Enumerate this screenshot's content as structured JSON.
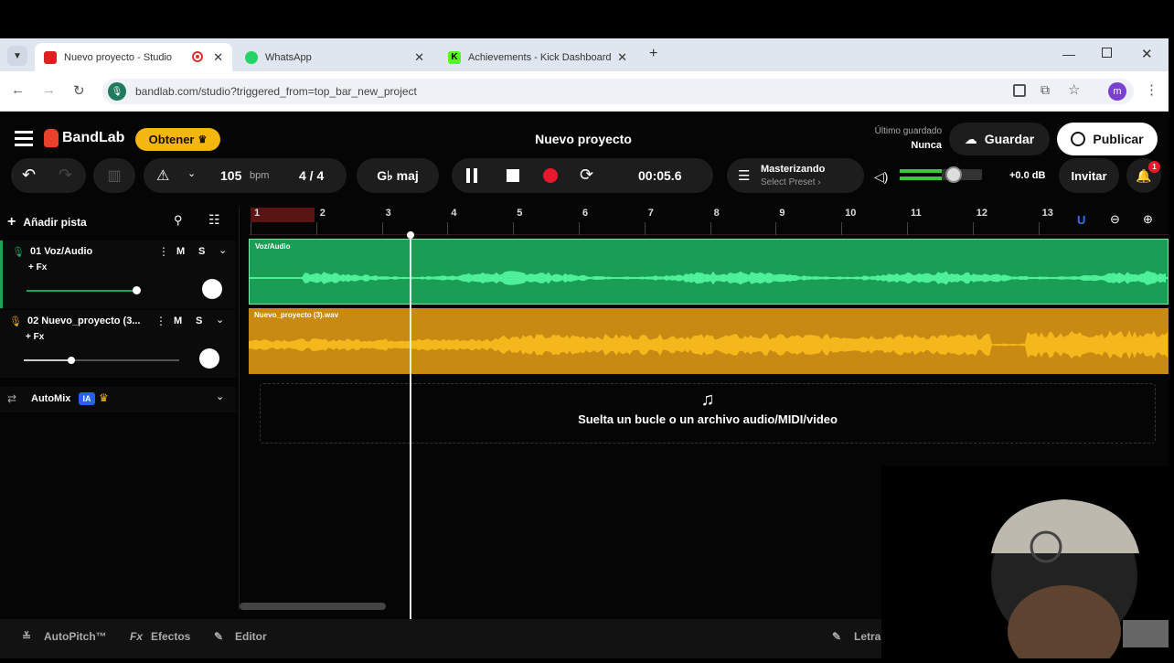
{
  "browser": {
    "tabs": [
      {
        "title": "Nuevo proyecto - Studio",
        "active": true
      },
      {
        "title": "WhatsApp",
        "active": false
      },
      {
        "title": "Achievements - Kick Dashboard",
        "active": false
      }
    ],
    "url": "bandlab.com/studio?triggered_from=top_bar_new_project",
    "profile_initial": "m"
  },
  "app": {
    "logo": "BandLab",
    "get_button": "Obtener",
    "project_title": "Nuevo proyecto",
    "last_saved_label": "Último guardado",
    "last_saved_value": "Nunca",
    "save_button": "Guardar",
    "publish_button": "Publicar"
  },
  "toolbar": {
    "bpm_value": "105",
    "bpm_unit": "bpm",
    "time_signature": "4 / 4",
    "key": "G♭ maj",
    "time": "00:05.6",
    "mastering_title": "Masterizando",
    "mastering_sub": "Select Preset ›",
    "volume_db": "+0.0 dB",
    "invite_button": "Invitar",
    "notification_count": "1"
  },
  "tracks_panel": {
    "add_track": "Añadir pista",
    "tracks": [
      {
        "name": "01  Voz/Audio",
        "fx": "+ Fx",
        "m": "M",
        "s": "S",
        "color": "#1ea45a",
        "region_label": "Voz/Audio"
      },
      {
        "name": "02  Nuevo_proyecto (3...",
        "fx": "+ Fx",
        "m": "M",
        "s": "S",
        "color": "#e4a41b",
        "region_label": "Nuevo_proyecto (3).wav"
      }
    ],
    "automix": "AutoMix",
    "automix_badge": "IA"
  },
  "ruler": [
    "1",
    "2",
    "3",
    "4",
    "5",
    "6",
    "7",
    "8",
    "9",
    "10",
    "11",
    "12",
    "13"
  ],
  "drop_zone": "Suelta un bucle o un archivo audio/MIDI/video",
  "bottom": {
    "autopitch": "AutoPitch™",
    "effects": "Efectos",
    "editor": "Editor",
    "lyrics": "Letra"
  }
}
